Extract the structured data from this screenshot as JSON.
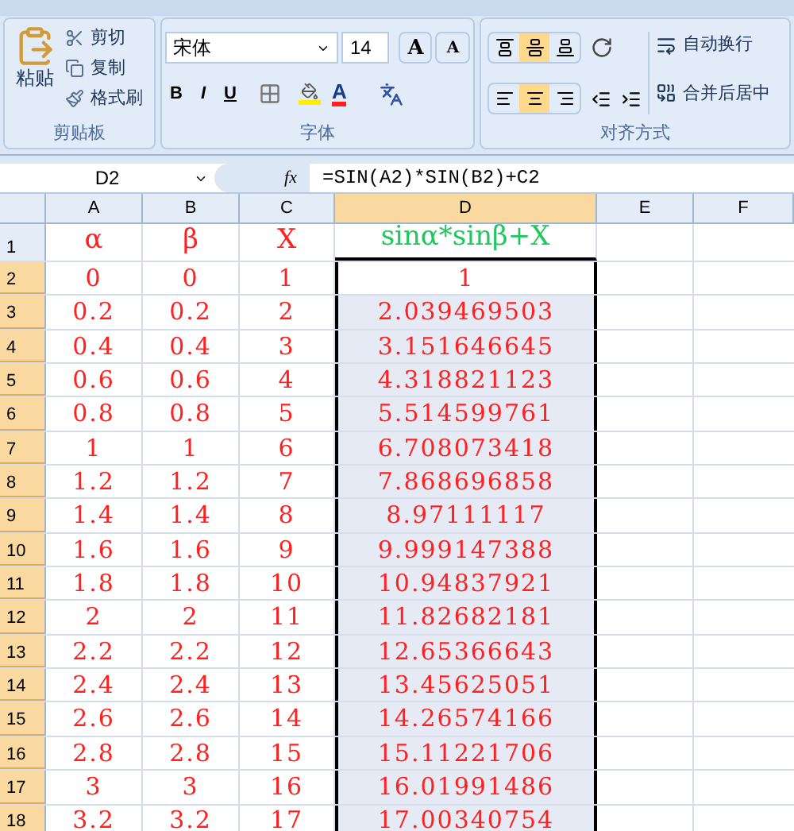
{
  "ribbon": {
    "clipboard": {
      "paste": "粘贴",
      "items": [
        {
          "kind": "cut",
          "label": "剪切"
        },
        {
          "kind": "copy",
          "label": "复制"
        },
        {
          "kind": "format",
          "label": "格式刷"
        }
      ],
      "label": "剪贴板"
    },
    "font": {
      "name": "宋体",
      "size": "14",
      "grow": "A",
      "shrink": "A",
      "bold": "B",
      "italic": "I",
      "underline": "U",
      "color_letter": "A",
      "label": "字体"
    },
    "alignment": {
      "vertical": [
        {
          "kind": "top",
          "selected": false
        },
        {
          "kind": "middle",
          "selected": true
        },
        {
          "kind": "bottom",
          "selected": false
        }
      ],
      "horizontal": [
        {
          "kind": "left",
          "selected": false
        },
        {
          "kind": "center",
          "selected": true
        },
        {
          "kind": "right",
          "selected": false
        }
      ],
      "wrap": "自动换行",
      "merge": "合并后居中",
      "label": "对齐方式"
    }
  },
  "formula_bar": {
    "name_box": "D2",
    "fx": "fx",
    "formula": "=SIN(A2)*SIN(B2)+C2"
  },
  "sheet": {
    "columns": [
      {
        "label": "A",
        "selected": false
      },
      {
        "label": "B",
        "selected": false
      },
      {
        "label": "C",
        "selected": false
      },
      {
        "label": "D",
        "selected": true
      },
      {
        "label": "E",
        "selected": false
      },
      {
        "label": "F",
        "selected": false
      }
    ],
    "header_row": {
      "number": "1",
      "cells": [
        {
          "text": "α",
          "color": "#ff2020"
        },
        {
          "text": "β",
          "color": "#ff2020"
        },
        {
          "text": "X",
          "color": "#ff2020"
        },
        {
          "text": "sinα*sinβ+X",
          "color": "#22c55e"
        }
      ]
    },
    "rows": [
      {
        "number": "2",
        "selected": true,
        "active": true,
        "cells": [
          "0",
          "0",
          "1",
          "1"
        ]
      },
      {
        "number": "3",
        "selected": true,
        "active": false,
        "cells": [
          "0.2",
          "0.2",
          "2",
          "2.039469503"
        ]
      },
      {
        "number": "4",
        "selected": true,
        "active": false,
        "cells": [
          "0.4",
          "0.4",
          "3",
          "3.151646645"
        ]
      },
      {
        "number": "5",
        "selected": true,
        "active": false,
        "cells": [
          "0.6",
          "0.6",
          "4",
          "4.318821123"
        ]
      },
      {
        "number": "6",
        "selected": true,
        "active": false,
        "cells": [
          "0.8",
          "0.8",
          "5",
          "5.514599761"
        ]
      },
      {
        "number": "7",
        "selected": true,
        "active": false,
        "cells": [
          "1",
          "1",
          "6",
          "6.708073418"
        ]
      },
      {
        "number": "8",
        "selected": true,
        "active": false,
        "cells": [
          "1.2",
          "1.2",
          "7",
          "7.868696858"
        ]
      },
      {
        "number": "9",
        "selected": true,
        "active": false,
        "cells": [
          "1.4",
          "1.4",
          "8",
          "8.97111117"
        ]
      },
      {
        "number": "10",
        "selected": true,
        "active": false,
        "cells": [
          "1.6",
          "1.6",
          "9",
          "9.999147388"
        ]
      },
      {
        "number": "11",
        "selected": true,
        "active": false,
        "cells": [
          "1.8",
          "1.8",
          "10",
          "10.94837921"
        ]
      },
      {
        "number": "12",
        "selected": true,
        "active": false,
        "cells": [
          "2",
          "2",
          "11",
          "11.82682181"
        ]
      },
      {
        "number": "13",
        "selected": true,
        "active": false,
        "cells": [
          "2.2",
          "2.2",
          "12",
          "12.65366643"
        ]
      },
      {
        "number": "14",
        "selected": true,
        "active": false,
        "cells": [
          "2.4",
          "2.4",
          "13",
          "13.45625051"
        ]
      },
      {
        "number": "15",
        "selected": true,
        "active": false,
        "cells": [
          "2.6",
          "2.6",
          "14",
          "14.26574166"
        ]
      },
      {
        "number": "16",
        "selected": true,
        "active": false,
        "cells": [
          "2.8",
          "2.8",
          "15",
          "15.11221706"
        ]
      },
      {
        "number": "17",
        "selected": true,
        "active": false,
        "cells": [
          "3",
          "3",
          "16",
          "16.01991486"
        ]
      },
      {
        "number": "18",
        "selected": true,
        "active": false,
        "cells": [
          "3.2",
          "3.2",
          "17",
          "17.00340754"
        ]
      }
    ]
  }
}
